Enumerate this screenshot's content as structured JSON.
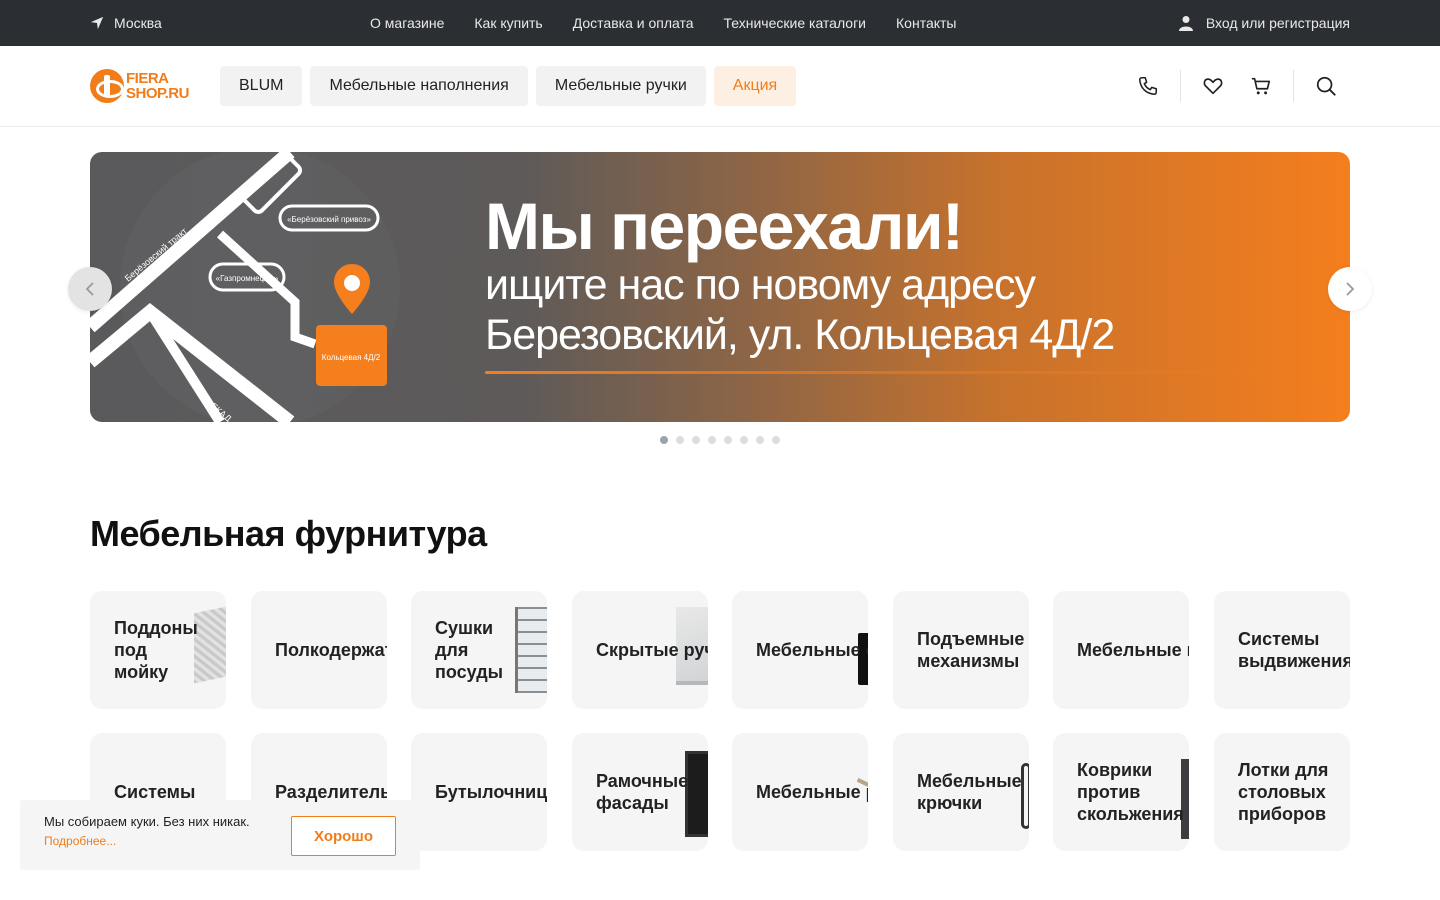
{
  "topbar": {
    "city": "Москва",
    "nav": [
      "О магазине",
      "Как купить",
      "Доставка и оплата",
      "Технические каталоги",
      "Контакты"
    ],
    "login": "Вход или регистрация"
  },
  "header": {
    "logo_line1": "FIERA",
    "logo_line2": "SHOP.RU",
    "categories": [
      "BLUM",
      "Мебельные наполнения",
      "Мебельные ручки",
      "Акция"
    ]
  },
  "banner": {
    "title": "Мы переехали!",
    "line1": "ищите нас по новому адресу",
    "line2": "Березовский, ул. Кольцевая 4Д/2",
    "map_labels": {
      "road": "Берёзовский тракт",
      "market": "«Берёзовский привоз»",
      "gas": "«Газпромнефть»",
      "address": "Кольцевая 4Д/2",
      "ring": "ЕКАД"
    },
    "slides": 8,
    "active_slide": 0
  },
  "section": {
    "title": "Мебельная фурнитура",
    "row1": [
      "Поддоны под мойку",
      "Полкодержатели",
      "Сушки для посуды",
      "Скрытые ручки",
      "Мебельные опоры",
      "Подъемные механизмы",
      "Мебельные петли",
      "Системы выдвижения"
    ],
    "row2": [
      "Системы",
      "Разделительные",
      "Бутылочницы",
      "Рамочные фасады",
      "Мебельные ручки",
      "Мебельные крючки",
      "Коврики против скольжения",
      "Лотки для столовых приборов"
    ]
  },
  "cookie": {
    "text": "Мы собираем куки. Без них никак.",
    "more": "Подробнее...",
    "ok": "Хорошо"
  },
  "colors": {
    "accent": "#f07d1a",
    "topbar": "#2b2f33"
  }
}
